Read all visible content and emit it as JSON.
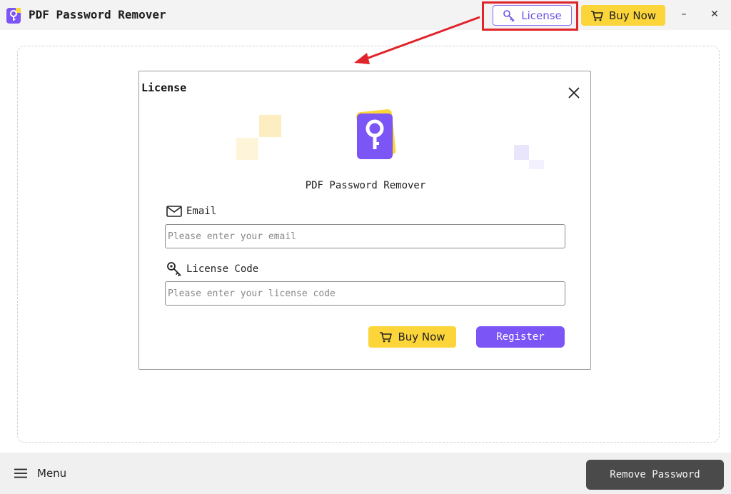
{
  "window": {
    "title": "PDF Password Remover",
    "license_label": "License",
    "buy_label": "Buy Now",
    "minimize_glyph": "–",
    "close_glyph": "✕"
  },
  "dialog": {
    "title": "License",
    "app_name": "PDF Password Remover",
    "email": {
      "label": "Email",
      "placeholder": "Please enter your email",
      "value": ""
    },
    "license_code": {
      "label": "License Code",
      "placeholder": "Please enter your license code",
      "value": ""
    },
    "buy_label": "Buy Now",
    "register_label": "Register"
  },
  "bottom": {
    "menu_label": "Menu",
    "remove_label": "Remove Password"
  },
  "colors": {
    "accent_purple": "#7b55f5",
    "buy_yellow": "#fcd53a",
    "highlight_red": "#e0242b",
    "dark_button": "#4a4a4a"
  },
  "icons": [
    "app-logo-icon",
    "key-icon",
    "cart-icon",
    "close-icon",
    "mail-icon",
    "hamburger-icon"
  ]
}
